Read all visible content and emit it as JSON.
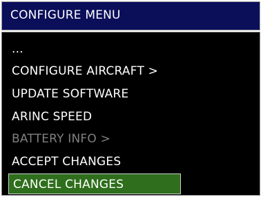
{
  "header": {
    "title": "CONFIGURE MENU"
  },
  "menu": {
    "items": [
      {
        "label": "...",
        "state": "normal"
      },
      {
        "label": "CONFIGURE AIRCRAFT >",
        "state": "normal"
      },
      {
        "label": "UPDATE SOFTWARE",
        "state": "normal"
      },
      {
        "label": "ARINC SPEED",
        "state": "normal"
      },
      {
        "label": "BATTERY INFO >",
        "state": "disabled"
      },
      {
        "label": "ACCEPT CHANGES",
        "state": "normal"
      },
      {
        "label": "CANCEL CHANGES",
        "state": "selected"
      }
    ]
  },
  "colors": {
    "title_bar": "#0b0f5a",
    "panel_background": "#000000",
    "text": "#ffffff",
    "disabled_text": "#808080",
    "selection_highlight": "#2e6e1c"
  }
}
